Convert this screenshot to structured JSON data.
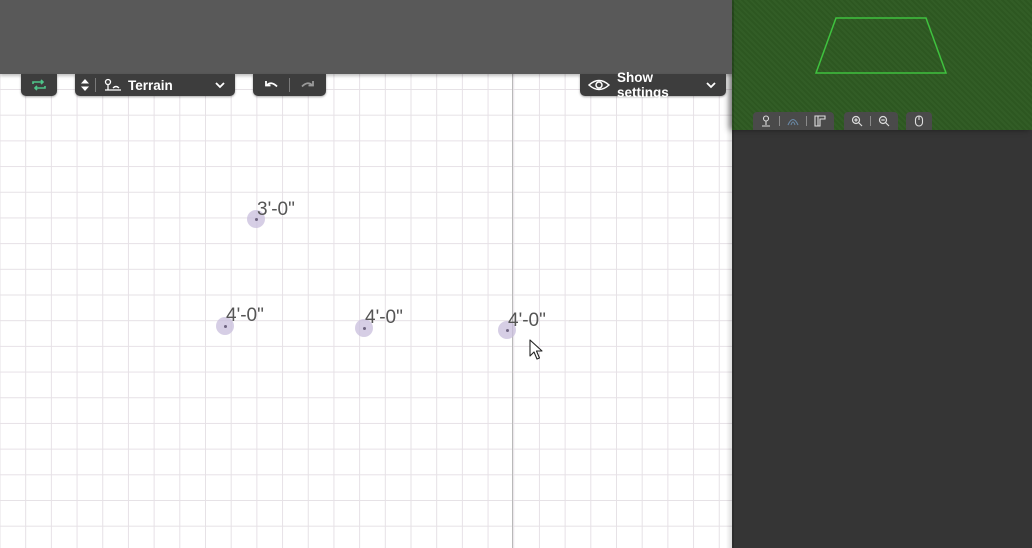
{
  "toolbar": {
    "layer_select": {
      "icon": "terrain-icon",
      "label": "Terrain",
      "dropdown_icon": "chevron-down-icon"
    },
    "undo_icon": "undo-icon",
    "redo_icon": "redo-icon",
    "settings": {
      "icon": "eye-icon",
      "label": "Show settings",
      "dropdown_icon": "chevron-down-icon"
    }
  },
  "canvas": {
    "elevation_points": [
      {
        "label": "3'-0\""
      },
      {
        "label": "4'-0\""
      },
      {
        "label": "4'-0\""
      },
      {
        "label": "4'-0\""
      }
    ]
  },
  "preview_toolbar": {
    "icons": [
      "person-view-icon",
      "terrain-view-icon",
      "plan-view-icon",
      "zoom-in-icon",
      "zoom-out-icon",
      "pan-icon"
    ]
  },
  "colors": {
    "topbar": "#595959",
    "toolbar": "#3d3d3d",
    "side_panel": "#353535",
    "preview_grass": "#2e5a22",
    "selection_outline": "#3fc23f",
    "sync_icon": "#4ec58a"
  }
}
